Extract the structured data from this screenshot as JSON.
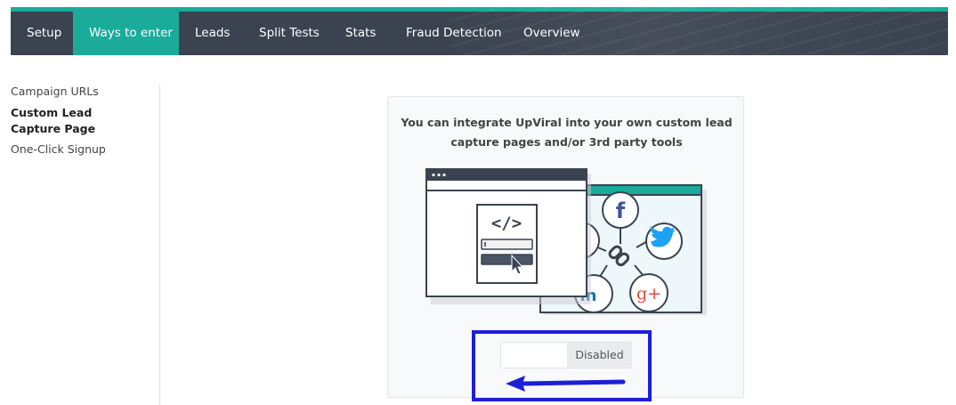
{
  "nav": {
    "tabs": [
      {
        "label": "Setup"
      },
      {
        "label": "Ways to enter"
      },
      {
        "label": "Leads"
      },
      {
        "label": "Split Tests"
      },
      {
        "label": "Stats"
      },
      {
        "label": "Fraud Detection"
      },
      {
        "label": "Overview"
      }
    ],
    "active_tab": "Ways to enter"
  },
  "sidebar": {
    "items": [
      {
        "label": "Campaign URLs"
      },
      {
        "label": "Custom Lead Capture Page"
      },
      {
        "label": "One-Click Signup"
      }
    ],
    "active_item": "Custom Lead Capture Page"
  },
  "card": {
    "description": "You can integrate UpViral into your own custom lead capture pages and/or 3rd party tools",
    "illustration_icons": [
      "code-icon",
      "link-icon",
      "facebook-icon",
      "twitter-icon",
      "linkedin-icon",
      "google-plus-icon",
      "cursor-icon"
    ],
    "code_glyph": "</>",
    "facebook_glyph": "f",
    "google_plus_glyph": "g+",
    "linkedin_glyph": "in"
  },
  "toggle": {
    "state_label": "Disabled",
    "enabled": false
  },
  "colors": {
    "nav_bg": "#3b4350",
    "accent": "#1aab9b",
    "annotation": "#1c1fd6"
  }
}
